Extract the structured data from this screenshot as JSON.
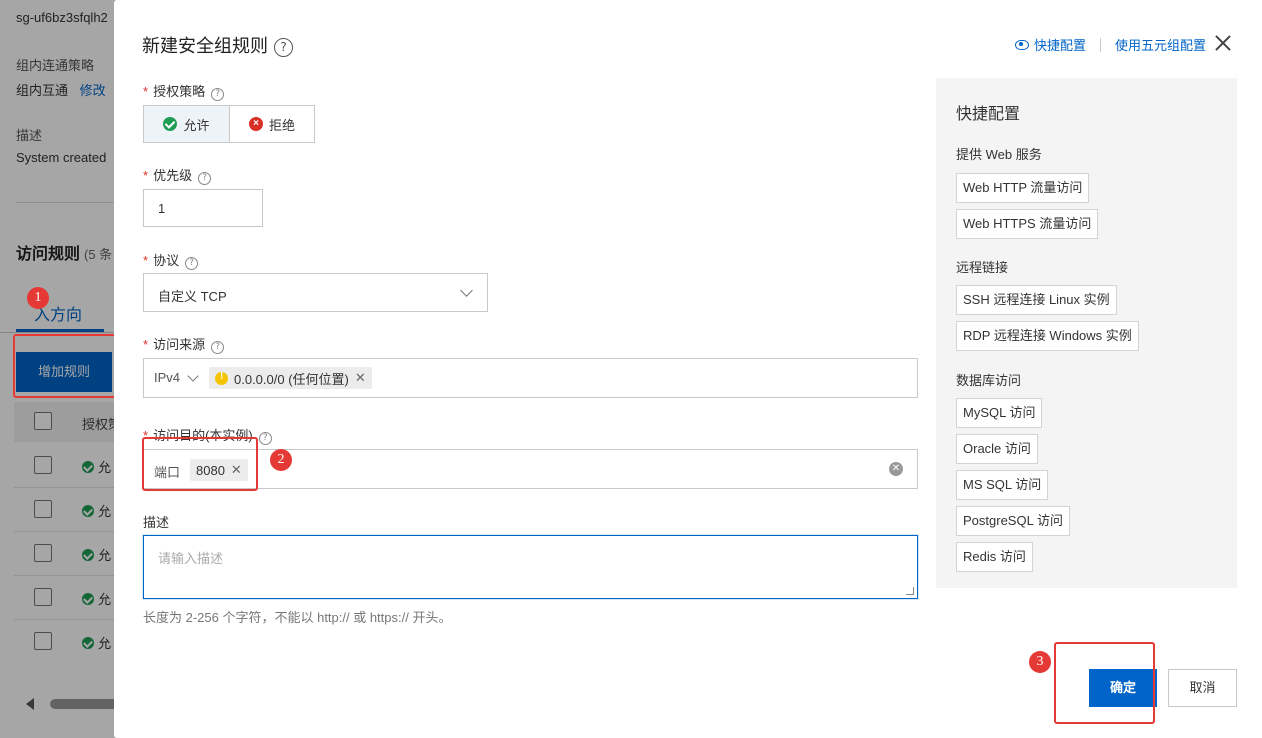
{
  "background": {
    "sg_id": "sg-uf6bz3sfqlh2",
    "intra_group_label": "组内连通策略",
    "intra_group_value": "组内互通",
    "modify_link": "修改",
    "description_label": "描述",
    "description_value": "System created",
    "rules_title": "访问规则",
    "rules_count": "(5 条",
    "tab_inbound": "入方向",
    "add_rule_button": "增加规则",
    "table_header_policy": "授权策",
    "row_status": "允"
  },
  "annotations": {
    "step1": "1",
    "step2": "2",
    "step3": "3"
  },
  "dialog": {
    "title": "新建安全组规则",
    "quick_config_link": "快捷配置",
    "five_tuple_link": "使用五元组配置",
    "policy": {
      "label": "授权策略",
      "allow": "允许",
      "deny": "拒绝",
      "selected": "允许"
    },
    "priority": {
      "label": "优先级",
      "value": "1"
    },
    "protocol": {
      "label": "协议",
      "value": "自定义 TCP"
    },
    "source": {
      "label": "访问来源",
      "ip_version": "IPv4",
      "tag": "0.0.0.0/0 (任何位置)"
    },
    "destination": {
      "label": "访问目的(本实例)",
      "prefix": "端口",
      "tag": "8080"
    },
    "description": {
      "label": "描述",
      "placeholder": "请输入描述",
      "hint": "长度为 2-256 个字符，不能以 http:// 或 https:// 开头。"
    },
    "quick_panel": {
      "title": "快捷配置",
      "groups": [
        {
          "title": "提供 Web 服务",
          "items": [
            "Web HTTP 流量访问",
            "Web HTTPS 流量访问"
          ]
        },
        {
          "title": "远程链接",
          "items": [
            "SSH 远程连接 Linux 实例",
            "RDP 远程连接 Windows 实例"
          ]
        },
        {
          "title": "数据库访问",
          "items": [
            "MySQL 访问",
            "Oracle 访问",
            "MS SQL 访问",
            "PostgreSQL 访问",
            "Redis 访问"
          ]
        }
      ]
    },
    "confirm_button": "确定",
    "cancel_button": "取消"
  },
  "colors": {
    "primary": "#0064c8",
    "annotation_red": "#e53935",
    "allow_green": "#1f9d55",
    "deny_red": "#d93026"
  }
}
